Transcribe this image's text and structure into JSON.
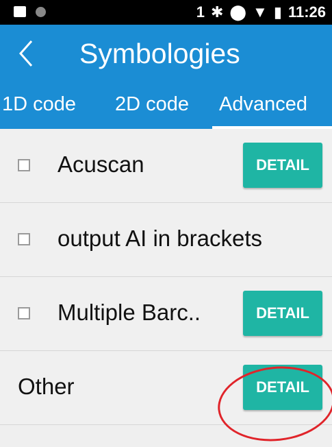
{
  "status_bar": {
    "sim": "1",
    "time": "11:26"
  },
  "header": {
    "title": "Symbologies"
  },
  "tabs": [
    {
      "label": "1D code"
    },
    {
      "label": "2D code"
    },
    {
      "label": "Advanced"
    }
  ],
  "rows": [
    {
      "label": "Acuscan",
      "button": "DETAIL"
    },
    {
      "label": "output AI in brackets"
    },
    {
      "label": "Multiple Barc..",
      "button": "DETAIL"
    },
    {
      "label": "Other",
      "button": "DETAIL"
    }
  ],
  "colors": {
    "accent": "#1b8dd4",
    "button": "#1fb5a4",
    "annotation": "#e0242a"
  }
}
